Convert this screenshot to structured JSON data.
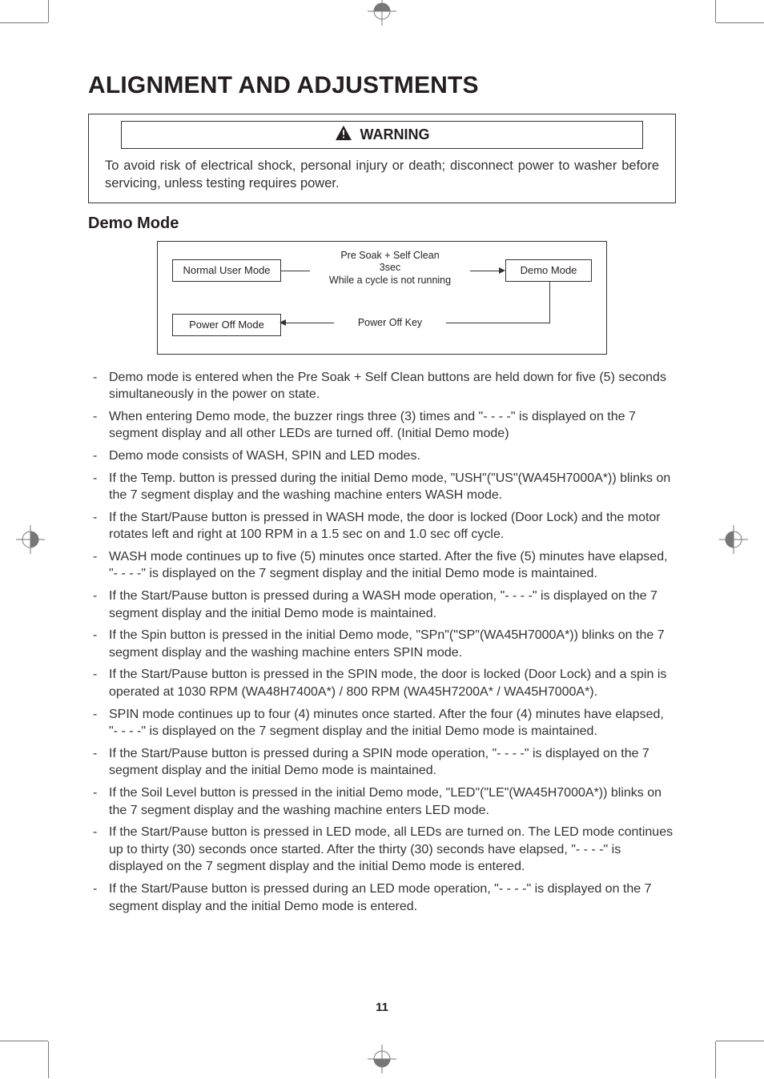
{
  "title": "ALIGNMENT AND ADJUSTMENTS",
  "warning": {
    "label": "WARNING",
    "body": "To avoid risk of electrical shock, personal injury or death; disconnect power to washer before servicing, unless testing requires power."
  },
  "section_heading": "Demo Mode",
  "diagram": {
    "normal_user_mode": "Normal User Mode",
    "demo_mode": "Demo Mode",
    "power_off_mode": "Power Off Mode",
    "top_label_l1": "Pre Soak + Self Clean",
    "top_label_l2": "3sec",
    "top_label_l3": "While a cycle is not running",
    "bottom_label": "Power Off Key"
  },
  "bullets": [
    "Demo mode is entered when the Pre Soak + Self Clean buttons are held down for five (5) seconds simultaneously in the power on state.",
    "When entering Demo mode, the buzzer rings three (3) times and \"- - - -\" is displayed on the 7 segment display and all other LEDs are turned off. (Initial Demo mode)",
    "Demo mode consists of WASH, SPIN and LED modes.",
    "If the Temp. button is pressed during the initial Demo mode, \"USH\"(\"US\"(WA45H7000A*)) blinks on the 7 segment display and the washing machine enters WASH mode.",
    "If the Start/Pause button is pressed in WASH mode, the door is locked (Door Lock) and the motor rotates left and right at 100 RPM in a 1.5 sec on and 1.0 sec off cycle.",
    "WASH mode continues up to five (5) minutes once started. After the five (5) minutes have elapsed, \"- - - -\" is displayed on the 7 segment display and the initial Demo mode is maintained.",
    "If the Start/Pause button is pressed during a WASH mode operation, \"- - - -\" is displayed on the 7 segment display and the initial Demo mode is maintained.",
    "If the Spin button is pressed in the initial Demo mode, \"SPn\"(\"SP\"(WA45H7000A*)) blinks on the 7 segment display and the washing machine enters SPIN mode.",
    "If the Start/Pause button is pressed in the SPIN mode, the door is locked (Door Lock) and a spin is operated at 1030 RPM (WA48H7400A*) / 800 RPM (WA45H7200A* / WA45H7000A*).",
    "SPIN mode continues up to four (4) minutes once started. After the four (4) minutes have elapsed, \"- - - -\" is displayed on the 7 segment display and the initial Demo mode is maintained.",
    "If the Start/Pause button is pressed during a SPIN mode operation, \"- - - -\" is displayed on the 7 segment display and the initial Demo mode is maintained.",
    "If the Soil Level button is pressed in the initial Demo mode, \"LED\"(\"LE\"(WA45H7000A*)) blinks on the 7 segment display and the washing machine enters LED mode.",
    "If the Start/Pause button is pressed in LED mode, all LEDs are turned on. The LED mode continues up to thirty (30) seconds once started. After the thirty (30) seconds have elapsed, \"- - - -\" is displayed on the 7 segment display and the initial Demo mode is entered.",
    "If the Start/Pause button is pressed during an LED mode operation, \"- - - -\" is displayed on the 7 segment display and the initial Demo mode is entered."
  ],
  "page_number": "11"
}
